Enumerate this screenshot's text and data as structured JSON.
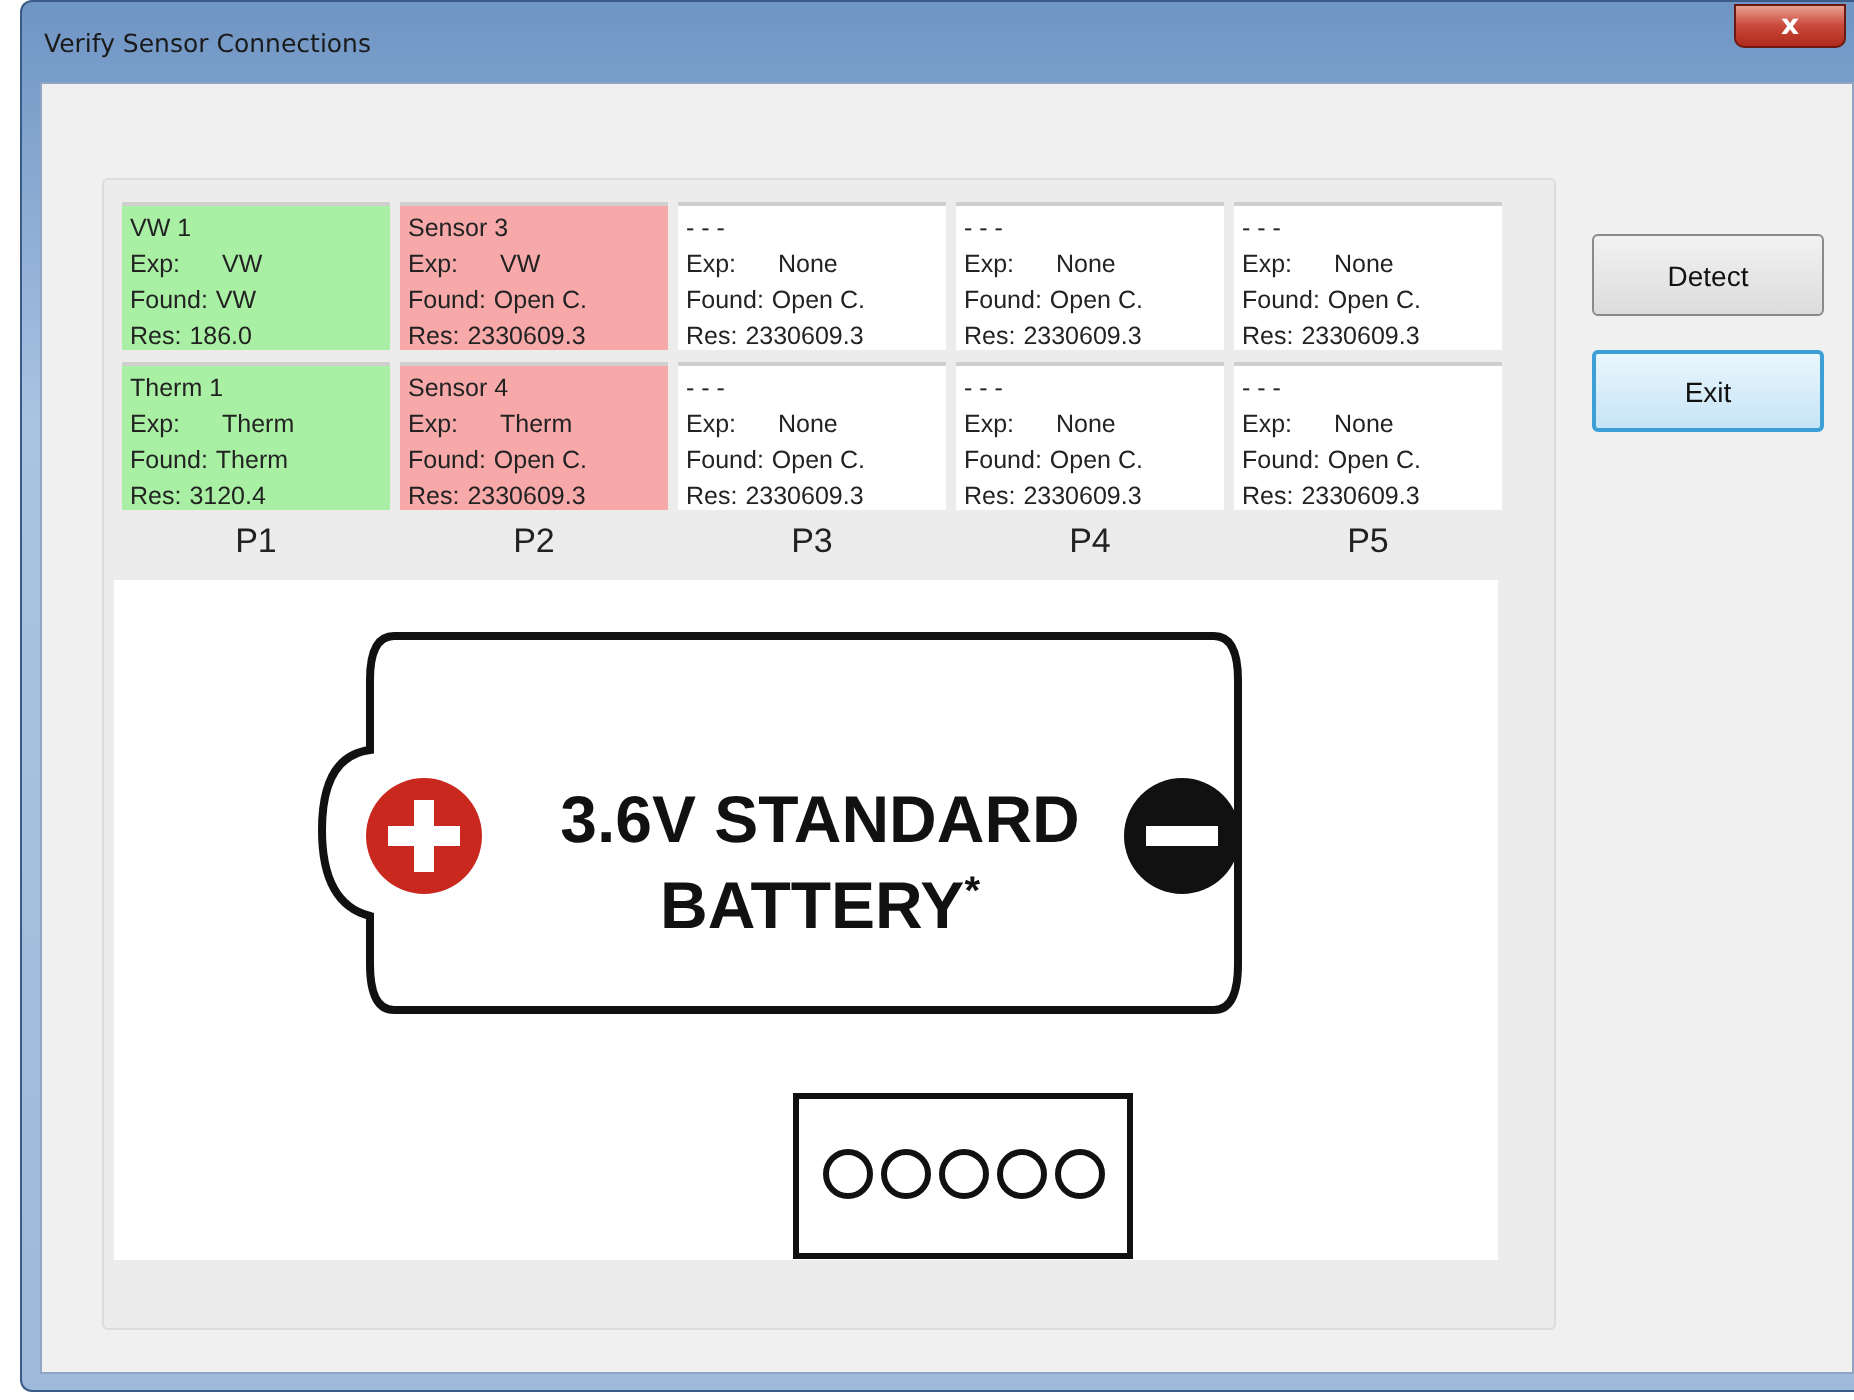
{
  "window": {
    "title": "Verify Sensor Connections",
    "close_label": "x"
  },
  "ports": [
    {
      "label": "P1",
      "sensors": [
        {
          "color": "#a9f0a4",
          "name": "VW 1",
          "lines": [
            {
              "label": "Exp:",
              "value": "VW"
            },
            {
              "label": "Found:",
              "value": "VW"
            },
            {
              "label": "Res:",
              "value": "186.0"
            }
          ]
        },
        {
          "color": "#a9f0a4",
          "name": "Therm 1",
          "lines": [
            {
              "label": "Exp:",
              "value": "Therm"
            },
            {
              "label": "Found:",
              "value": "Therm"
            },
            {
              "label": "Res:",
              "value": "3120.4"
            }
          ]
        }
      ]
    },
    {
      "label": "P2",
      "sensors": [
        {
          "color": "#f7a9a9",
          "name": "Sensor 3",
          "lines": [
            {
              "label": "Exp:",
              "value": "VW"
            },
            {
              "label": "Found:",
              "value": "Open C."
            },
            {
              "label": "Res:",
              "value": "2330609.3"
            }
          ]
        },
        {
          "color": "#f7a9a9",
          "name": "Sensor 4",
          "lines": [
            {
              "label": "Exp:",
              "value": "Therm"
            },
            {
              "label": "Found:",
              "value": "Open C."
            },
            {
              "label": "Res:",
              "value": "2330609.3"
            }
          ]
        }
      ]
    },
    {
      "label": "P3",
      "sensors": [
        {
          "color": "#ffffff",
          "name": "- - -",
          "lines": [
            {
              "label": "Exp:",
              "value": "None"
            },
            {
              "label": "Found:",
              "value": "Open C."
            },
            {
              "label": "Res:",
              "value": "2330609.3"
            }
          ]
        },
        {
          "color": "#ffffff",
          "name": "- - -",
          "lines": [
            {
              "label": "Exp:",
              "value": "None"
            },
            {
              "label": "Found:",
              "value": "Open C."
            },
            {
              "label": "Res:",
              "value": "2330609.3"
            }
          ]
        }
      ]
    },
    {
      "label": "P4",
      "sensors": [
        {
          "color": "#ffffff",
          "name": "- - -",
          "lines": [
            {
              "label": "Exp:",
              "value": "None"
            },
            {
              "label": "Found:",
              "value": "Open C."
            },
            {
              "label": "Res:",
              "value": "2330609.3"
            }
          ]
        },
        {
          "color": "#ffffff",
          "name": "- - -",
          "lines": [
            {
              "label": "Exp:",
              "value": "None"
            },
            {
              "label": "Found:",
              "value": "Open C."
            },
            {
              "label": "Res:",
              "value": "2330609.3"
            }
          ]
        }
      ]
    },
    {
      "label": "P5",
      "sensors": [
        {
          "color": "#ffffff",
          "name": "- - -",
          "lines": [
            {
              "label": "Exp:",
              "value": "None"
            },
            {
              "label": "Found:",
              "value": "Open C."
            },
            {
              "label": "Res:",
              "value": "2330609.3"
            }
          ]
        },
        {
          "color": "#ffffff",
          "name": "- - -",
          "lines": [
            {
              "label": "Exp:",
              "value": "None"
            },
            {
              "label": "Found:",
              "value": "Open C."
            },
            {
              "label": "Res:",
              "value": "2330609.3"
            }
          ]
        }
      ]
    }
  ],
  "battery": {
    "label_lines": [
      "3.6V STANDARD",
      "BATTERY$^{*}$"
    ]
  },
  "buttons": [
    {
      "label": "Detect",
      "focused": false
    },
    {
      "label": "Exit",
      "focused": true
    }
  ]
}
